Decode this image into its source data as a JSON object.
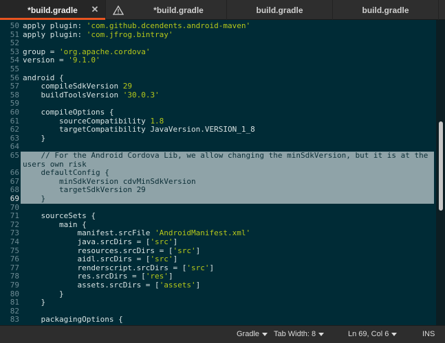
{
  "tabs": [
    {
      "label": "*build.gradle",
      "active": true
    },
    {
      "label": "*build.gradle",
      "active": false
    },
    {
      "label": "build.gradle",
      "active": false
    },
    {
      "label": "build.gradle",
      "active": false
    }
  ],
  "editor": {
    "lines": [
      {
        "n": "50",
        "text": "apply plugin: 'com.github.dcendents.android-maven'"
      },
      {
        "n": "51",
        "text": "apply plugin: 'com.jfrog.bintray'"
      },
      {
        "n": "52",
        "text": ""
      },
      {
        "n": "53",
        "text": "group = 'org.apache.cordova'"
      },
      {
        "n": "54",
        "text": "version = '9.1.0'"
      },
      {
        "n": "55",
        "text": ""
      },
      {
        "n": "56",
        "text": "android {"
      },
      {
        "n": "57",
        "text": "    compileSdkVersion 29"
      },
      {
        "n": "58",
        "text": "    buildToolsVersion '30.0.3'"
      },
      {
        "n": "59",
        "text": ""
      },
      {
        "n": "60",
        "text": "    compileOptions {"
      },
      {
        "n": "61",
        "text": "        sourceCompatibility 1.8"
      },
      {
        "n": "62",
        "text": "        targetCompatibility JavaVersion.VERSION_1_8"
      },
      {
        "n": "63",
        "text": "    }"
      },
      {
        "n": "64",
        "text": ""
      },
      {
        "n": "65",
        "text": "    // For the Android Cordova Lib, we allow changing the minSdkVersion, but it is at the"
      },
      {
        "n": "",
        "text": "users own risk"
      },
      {
        "n": "66",
        "text": "    defaultConfig {"
      },
      {
        "n": "67",
        "text": "        minSdkVersion cdvMinSdkVersion"
      },
      {
        "n": "68",
        "text": "        targetSdkVersion 29"
      },
      {
        "n": "69",
        "text": "    }"
      },
      {
        "n": "70",
        "text": ""
      },
      {
        "n": "71",
        "text": "    sourceSets {"
      },
      {
        "n": "72",
        "text": "        main {"
      },
      {
        "n": "73",
        "text": "            manifest.srcFile 'AndroidManifest.xml'"
      },
      {
        "n": "74",
        "text": "            java.srcDirs = ['src']"
      },
      {
        "n": "75",
        "text": "            resources.srcDirs = ['src']"
      },
      {
        "n": "76",
        "text": "            aidl.srcDirs = ['src']"
      },
      {
        "n": "77",
        "text": "            renderscript.srcDirs = ['src']"
      },
      {
        "n": "78",
        "text": "            res.srcDirs = ['res']"
      },
      {
        "n": "79",
        "text": "            assets.srcDirs = ['assets']"
      },
      {
        "n": "80",
        "text": "        }"
      },
      {
        "n": "81",
        "text": "    }"
      },
      {
        "n": "82",
        "text": ""
      },
      {
        "n": "83",
        "text": "    packagingOptions {"
      }
    ],
    "selected_start": 15,
    "selected_end": 20,
    "current_line": "69"
  },
  "statusbar": {
    "language": "Gradle",
    "tab_width": "Tab Width: 8",
    "position": "Ln 69, Col 6",
    "mode": "INS"
  },
  "colors": {
    "background": "#002b36",
    "string": "#b5c71a",
    "selection": "#8fa3a8",
    "accent": "#e95420"
  }
}
